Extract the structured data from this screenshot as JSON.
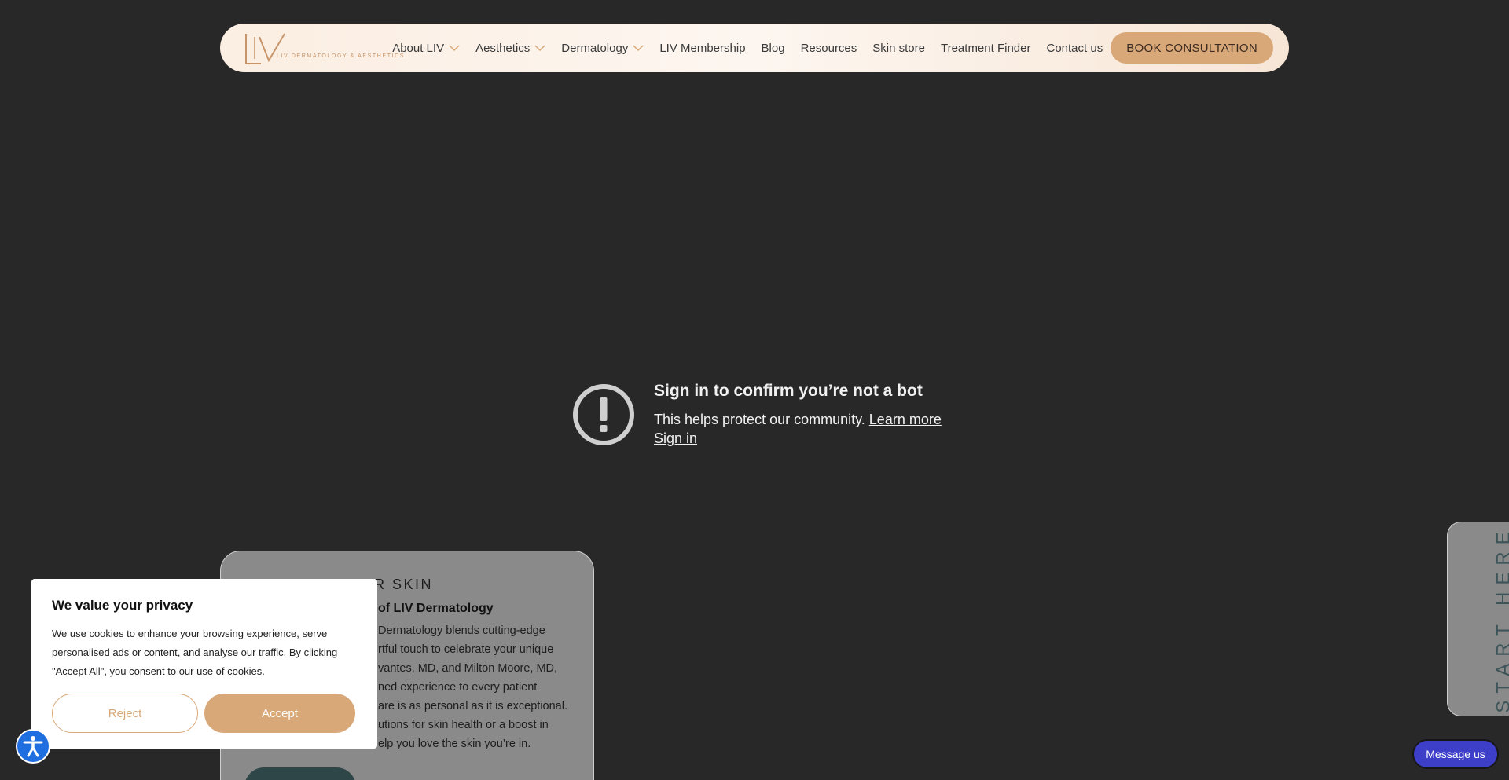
{
  "nav": {
    "logo_text": "LIV DERMATOLOGY & AESTHETICS",
    "items": [
      {
        "label": "About LIV",
        "dropdown": true
      },
      {
        "label": "Aesthetics",
        "dropdown": true
      },
      {
        "label": "Dermatology",
        "dropdown": true
      },
      {
        "label": "LIV Membership",
        "dropdown": false
      },
      {
        "label": "Blog",
        "dropdown": false
      },
      {
        "label": "Resources",
        "dropdown": false
      },
      {
        "label": "Skin store",
        "dropdown": false
      },
      {
        "label": "Treatment Finder",
        "dropdown": false
      },
      {
        "label": "Contact us",
        "dropdown": false
      }
    ],
    "cta_label": "BOOK CONSULTATION"
  },
  "bot_check": {
    "title": "Sign in to confirm you’re not a bot",
    "subtitle": "This helps protect our community.",
    "learn_more": "Learn more",
    "sign_in": "Sign in"
  },
  "card": {
    "heading": "R SKIN",
    "subheading": "of LIV Dermatology",
    "body_lines": [
      "Dermatology blends cutting-edge",
      "rtful touch to celebrate your unique",
      "vantes, MD, and Milton Moore, MD,",
      "ned experience to every patient",
      "are is as personal as it is exceptional.",
      "utions for skin health or a boost in",
      "elp you love the skin you’re in."
    ]
  },
  "cookie": {
    "title": "We value your privacy",
    "text": "We use cookies to enhance your browsing experience, serve personalised ads or content, and analyse our traffic. By clicking \"Accept All\", you consent to our use of cookies.",
    "reject_label": "Reject",
    "accept_label": "Accept"
  },
  "side_tab": {
    "label": "START HERE"
  },
  "chat": {
    "label": "Message us"
  },
  "colors": {
    "background": "#282828",
    "accent": "#d9a878",
    "nav_bg": "#fdf6f0",
    "a11y_blue": "#1f6fe0",
    "chat_blue": "#3e3fc9",
    "teal": "#2e4648"
  },
  "icons": {
    "alert": "exclamation-circle-icon",
    "accessibility": "accessibility-person-icon",
    "chevron": "chevron-down-icon"
  }
}
